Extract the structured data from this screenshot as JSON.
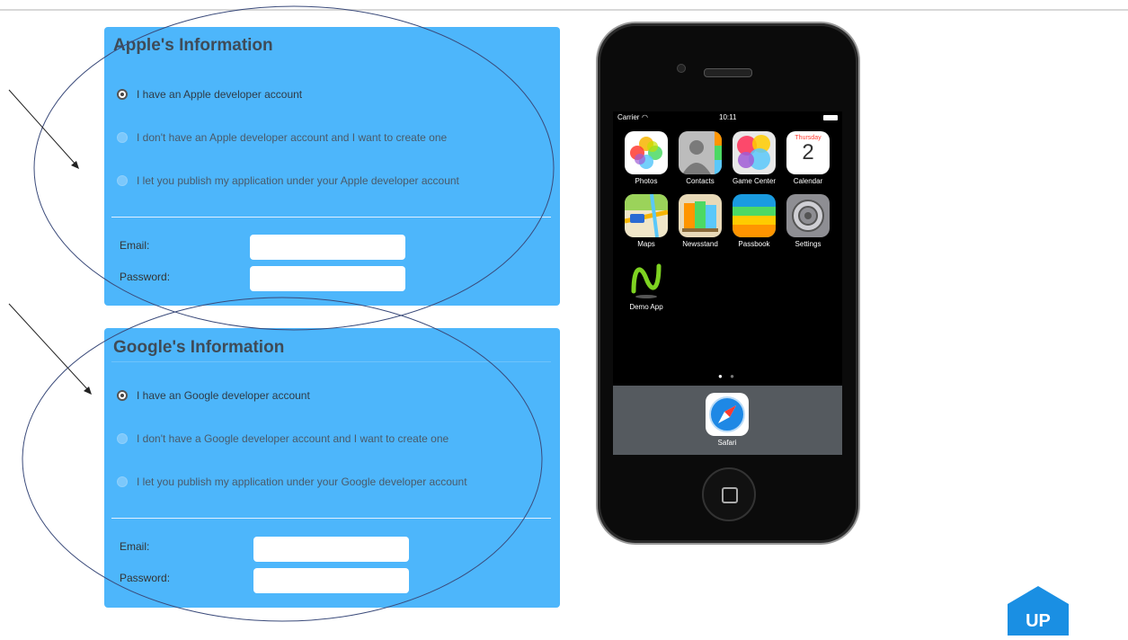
{
  "apple": {
    "title": "Apple's Information",
    "options": [
      "I have an Apple developer account",
      "I don't have an Apple developer account and I want to create one",
      "I let you publish my application under your Apple developer account"
    ],
    "selected": 0,
    "email_label": "Email:",
    "password_label": "Password:"
  },
  "google": {
    "title": "Google's Information",
    "options": [
      "I have an Google developer account",
      "I don't have a Google developer account and I want to create one",
      "I let you publish my application under your Google developer account"
    ],
    "selected": 0,
    "email_label": "Email:",
    "password_label": "Password:"
  },
  "phone": {
    "carrier": "Carrier",
    "time": "10:11",
    "calendar_day": "Thursday",
    "calendar_date": "2",
    "apps": [
      "Photos",
      "Contacts",
      "Game Center",
      "Calendar",
      "Maps",
      "Newsstand",
      "Passbook",
      "Settings",
      "Demo App"
    ],
    "dock_app": "Safari"
  },
  "up_button": {
    "label": "UP",
    "color": "#1a8fe3"
  },
  "colors": {
    "panel": "#4db6fb",
    "heading": "#3f4b57"
  }
}
